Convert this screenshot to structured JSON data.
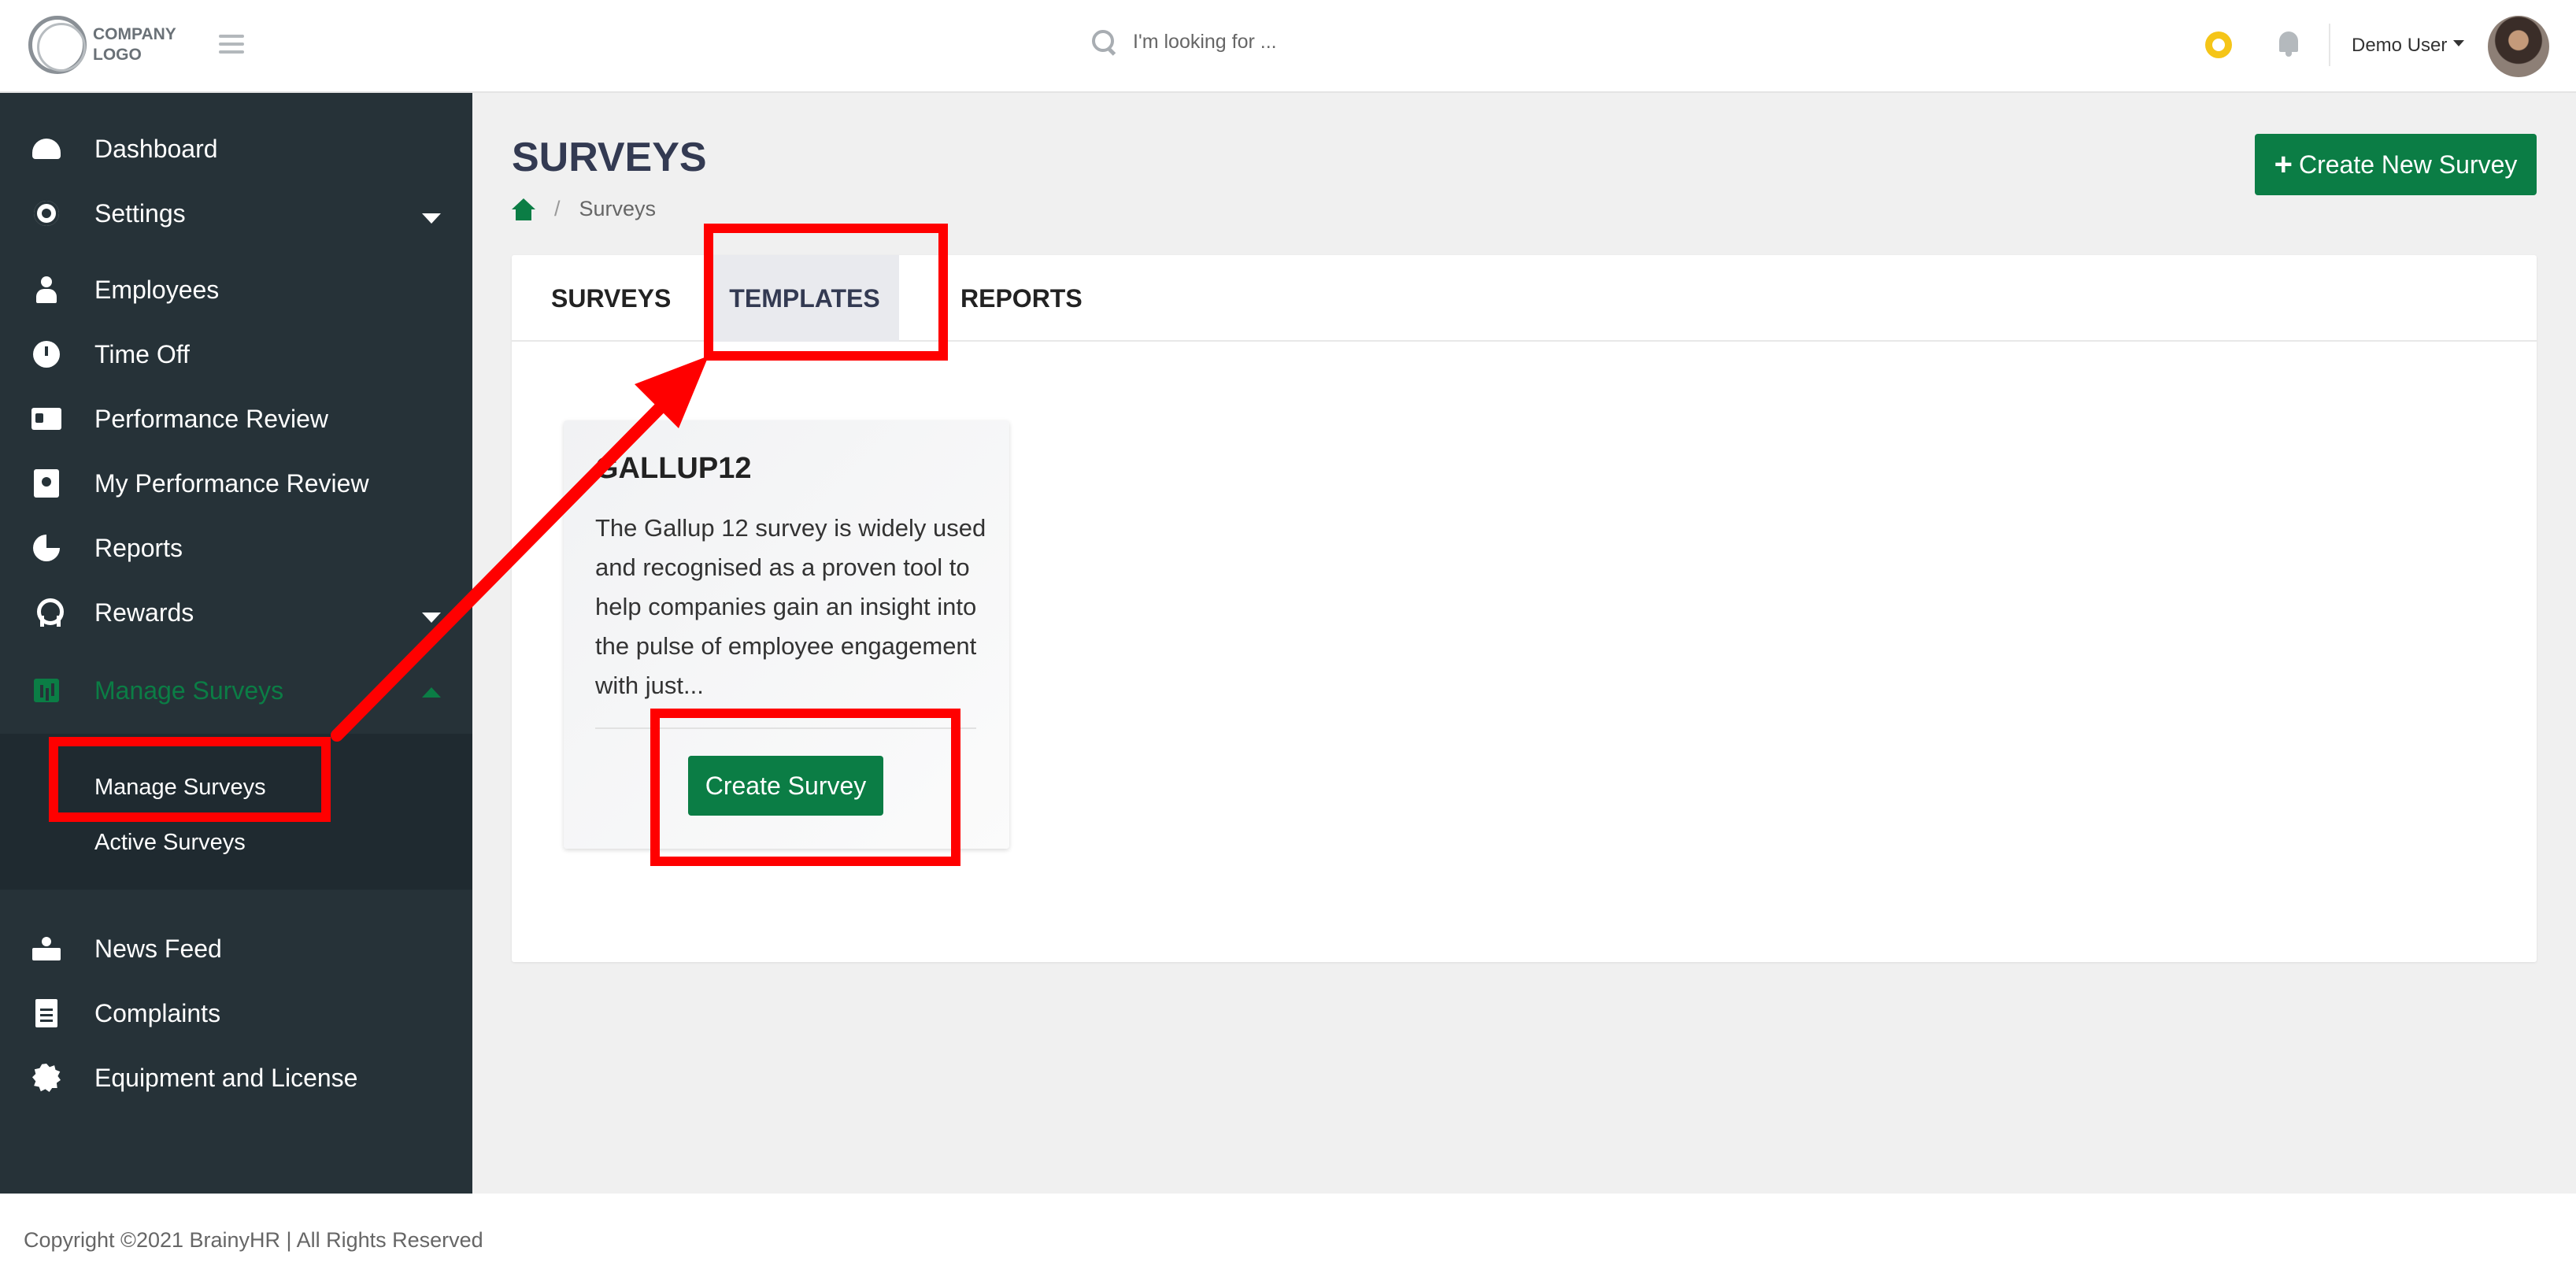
{
  "header": {
    "logo_text": "COMPANY LOGO",
    "search_placeholder": "I'm looking for ...",
    "user_name": "Demo User"
  },
  "sidebar": {
    "items": [
      {
        "label": "Dashboard",
        "icon": "dashboard-icon"
      },
      {
        "label": "Settings",
        "icon": "gear-icon"
      },
      {
        "label": "Employees",
        "icon": "user-icon"
      },
      {
        "label": "Time Off",
        "icon": "clock-icon"
      },
      {
        "label": "Performance Review",
        "icon": "id-card-icon"
      },
      {
        "label": "My Performance Review",
        "icon": "id-badge-icon"
      },
      {
        "label": "Reports",
        "icon": "pie-chart-icon"
      },
      {
        "label": "Rewards",
        "icon": "award-icon"
      },
      {
        "label": "Manage Surveys",
        "icon": "chart-icon"
      },
      {
        "label": "News Feed",
        "icon": "news-icon"
      },
      {
        "label": "Complaints",
        "icon": "document-icon"
      },
      {
        "label": "Equipment and License",
        "icon": "certificate-icon"
      }
    ],
    "submenu": [
      "Manage Surveys",
      "Active Surveys"
    ],
    "active_color": "#0b7d45"
  },
  "main": {
    "title": "SURVEYS",
    "breadcrumb": "Surveys",
    "create_new_label": "Create New Survey",
    "tabs": [
      "SURVEYS",
      "TEMPLATES",
      "REPORTS"
    ],
    "active_tab": "TEMPLATES",
    "card": {
      "title": "GALLUP12",
      "description": "The Gallup 12 survey is widely used and recognised as a proven tool to help companies gain an insight into the pulse of employee engagement with just...",
      "button_label": "Create Survey"
    }
  },
  "footer": {
    "text": "Copyright ©2021 BrainyHR | All Rights Reserved"
  },
  "colors": {
    "brand": "#0b7d45",
    "sidebar_bg": "#263238",
    "annotation": "#ff0000"
  }
}
